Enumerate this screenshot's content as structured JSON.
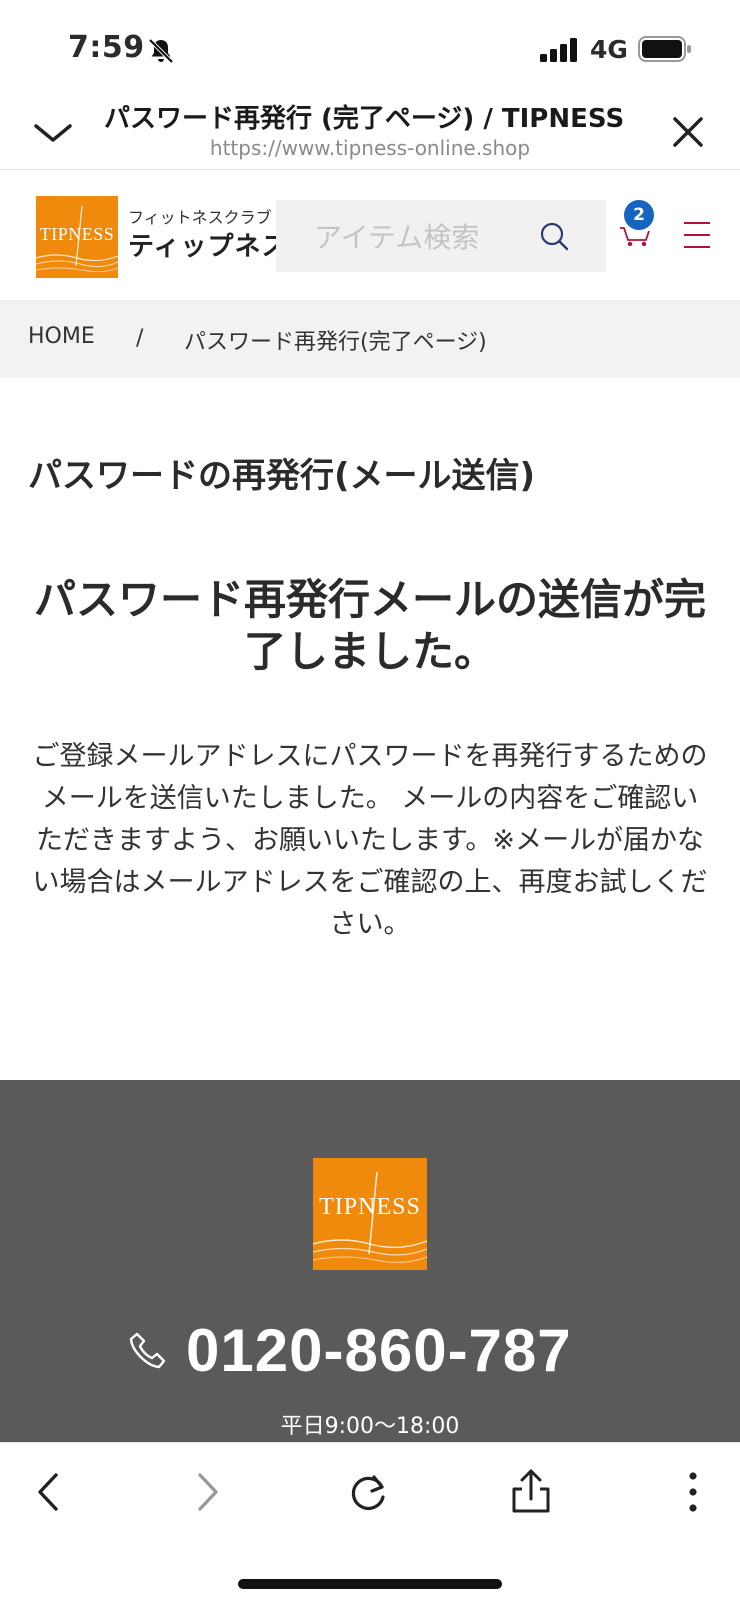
{
  "status_bar": {
    "time": "7:59",
    "network": "4G"
  },
  "browser": {
    "title": "パスワード再発行 (完了ページ) / TIPNESS",
    "url": "https://www.tipness-online.shop"
  },
  "header": {
    "logo_text": "TIPNESS",
    "logo_sub": "フィットネスクラブ",
    "logo_main": "ティップネス",
    "search_placeholder": "アイテム検索",
    "cart_count": "2"
  },
  "breadcrumb": {
    "home": "HOME",
    "separator": "/",
    "current": "パスワード再発行(完了ページ)"
  },
  "main": {
    "section_title": "パスワードの再発行(メール送信)",
    "heading": "パスワード再発行メールの送信が完了しました。",
    "message": "ご登録メールアドレスにパスワードを再発行するためのメールを送信いたしました。 メールの内容をご確認いただきますよう、お願いいたします。※メールが届かない場合はメールアドレスをご確認の上、再度お試しください。"
  },
  "footer": {
    "logo_text": "TIPNESS",
    "phone": "0120-860-787",
    "hours": "平日9:00〜18:00"
  },
  "icons": {
    "bell": "bell-slash-icon",
    "cart": "cart-icon",
    "menu": "hamburger-menu-icon",
    "search": "search-icon",
    "phone": "phone-icon"
  },
  "colors": {
    "brand_orange": "#f08a0c",
    "badge_blue": "#1565c0",
    "menu_red": "#b0123a",
    "footer_gray": "#5a5a5a"
  }
}
